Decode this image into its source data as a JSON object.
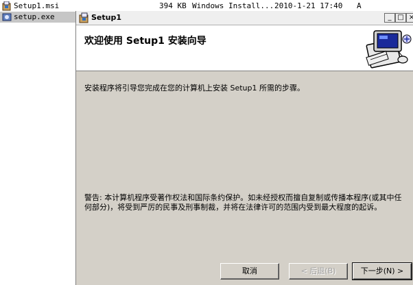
{
  "files": [
    {
      "name": "Setup1.msi",
      "size": "394 KB",
      "type": "Windows Install...",
      "date": "2010-1-21 17:40",
      "attr": "A",
      "icon": "msi-package-icon"
    },
    {
      "name": "setup.exe",
      "size": "",
      "type": "",
      "date": "",
      "attr": "",
      "icon": "setup-exe-icon"
    }
  ],
  "dialog": {
    "title": "Setup1",
    "title_buttons": {
      "minimize": "_",
      "maximize": "□",
      "close": "×"
    },
    "header_title": "欢迎使用 Setup1 安装向导",
    "body_text": "安装程序将引导您完成在您的计算机上安装 Setup1 所需的步骤。",
    "warning_text": "警告: 本计算机程序受著作权法和国际条约保护。如未经授权而擅自复制或传播本程序(或其中任何部分)，将受到严厉的民事及刑事制裁，并将在法律许可的范围内受到最大程度的起诉。",
    "buttons": {
      "cancel": "取消",
      "back": "< 后退(B)",
      "next": "下一步(N) >"
    }
  }
}
